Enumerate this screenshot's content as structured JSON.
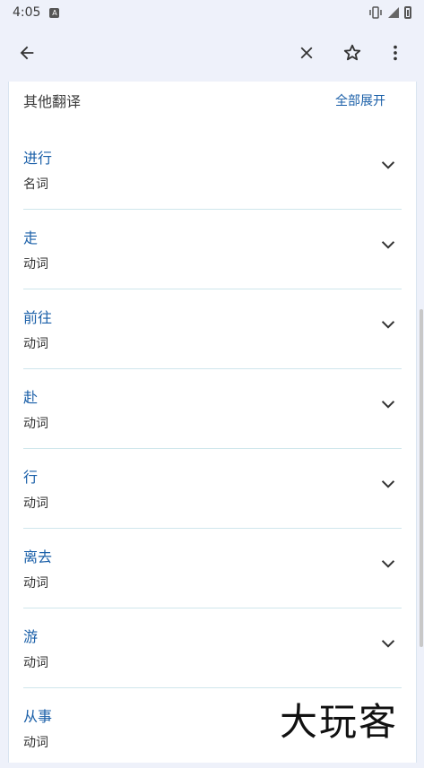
{
  "status": {
    "time": "4:05",
    "notif_icon": "A"
  },
  "toolbar": {
    "back_icon": "arrow-left-icon",
    "close_icon": "close-icon",
    "star_icon": "star-icon",
    "more_icon": "more-vert-icon"
  },
  "panel": {
    "title": "其他翻译",
    "expand_all": "全部展开",
    "items": [
      {
        "word": "进行",
        "pos": "名词"
      },
      {
        "word": "走",
        "pos": "动词"
      },
      {
        "word": "前往",
        "pos": "动词"
      },
      {
        "word": "赴",
        "pos": "动词"
      },
      {
        "word": "行",
        "pos": "动词"
      },
      {
        "word": "离去",
        "pos": "动词"
      },
      {
        "word": "游",
        "pos": "动词"
      },
      {
        "word": "从事",
        "pos": "动词"
      }
    ]
  },
  "watermark": "大玩客",
  "colors": {
    "accent": "#1a5fa8",
    "divider": "#cfe6ec",
    "background": "#eef1fa"
  }
}
